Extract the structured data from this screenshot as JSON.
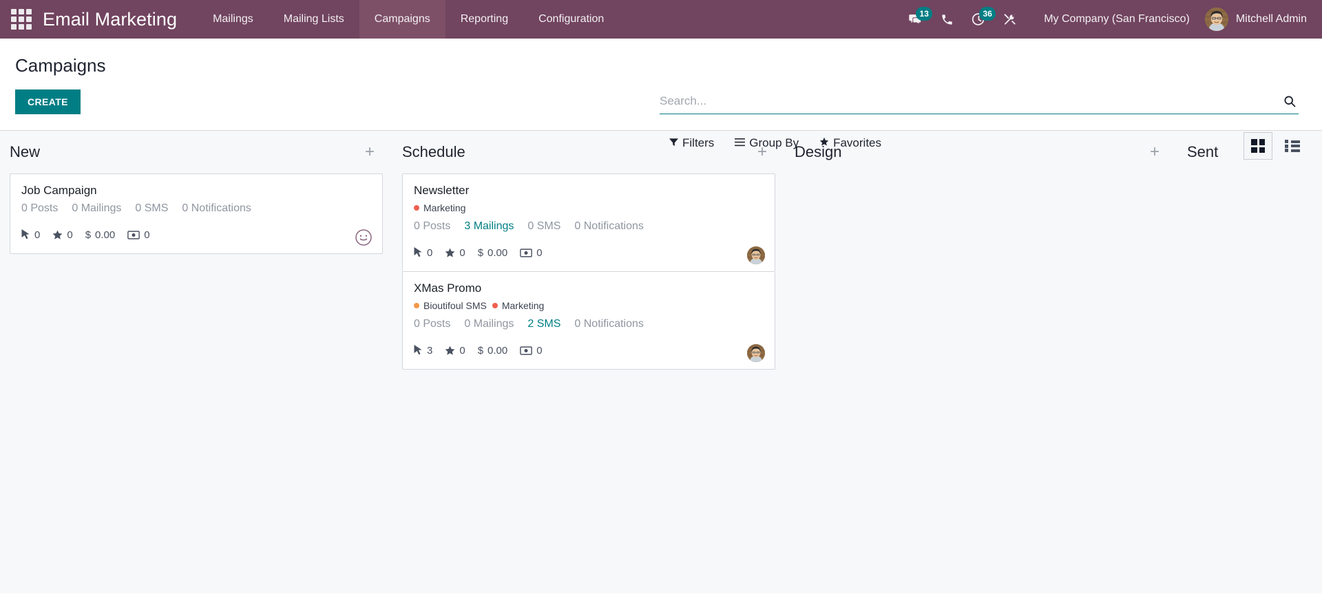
{
  "navbar": {
    "apps_icon": "apps-grid-icon",
    "brand": "Email Marketing",
    "menu": [
      {
        "label": "Mailings",
        "active": false
      },
      {
        "label": "Mailing Lists",
        "active": false
      },
      {
        "label": "Campaigns",
        "active": true
      },
      {
        "label": "Reporting",
        "active": false
      },
      {
        "label": "Configuration",
        "active": false
      }
    ],
    "icons": [
      {
        "name": "messages-icon",
        "badge": "13"
      },
      {
        "name": "phone-icon",
        "badge": ""
      },
      {
        "name": "activities-clock-icon",
        "badge": "36"
      },
      {
        "name": "developer-tools-icon",
        "badge": ""
      }
    ],
    "company": "My Company (San Francisco)",
    "user": "Mitchell Admin",
    "bg_color": "#71445F",
    "active_tab_color": "#7E5068",
    "badge_color": "#017E84"
  },
  "control_panel": {
    "title": "Campaigns",
    "create_label": "CREATE",
    "create_color": "#017E84",
    "search": {
      "placeholder": "Search...",
      "value": "",
      "icon": "search-icon"
    },
    "filters": [
      {
        "label": "Filters",
        "icon": "filter-funnel-icon"
      },
      {
        "label": "Group By",
        "icon": "bars-icon"
      },
      {
        "label": "Favorites",
        "icon": "star-icon"
      }
    ],
    "views": [
      {
        "name": "kanban-view-button",
        "icon": "kanban-icon",
        "active": true
      },
      {
        "name": "list-view-button",
        "icon": "list-icon",
        "active": false
      }
    ]
  },
  "kanban": {
    "add_symbol": "+",
    "columns": [
      {
        "title": "New",
        "cards": [
          {
            "title": "Job Campaign",
            "tags": [],
            "stats": [
              {
                "label": "0 Posts",
                "link": false
              },
              {
                "label": "0 Mailings",
                "link": false
              },
              {
                "label": "0 SMS",
                "link": false
              },
              {
                "label": "0 Notifications",
                "link": false
              }
            ],
            "metrics": [
              {
                "icon": "cursor-clicks-icon",
                "value": "0"
              },
              {
                "icon": "star-leads-icon",
                "value": "0"
              },
              {
                "icon": "dollar-icon",
                "value": "0.00"
              },
              {
                "icon": "banknote-revenue-icon",
                "value": "0"
              }
            ],
            "avatar": "smiley-placeholder"
          }
        ]
      },
      {
        "title": "Schedule",
        "cards": [
          {
            "title": "Newsletter",
            "tags": [
              {
                "label": "Marketing",
                "color": "#F06050"
              }
            ],
            "stats": [
              {
                "label": "0 Posts",
                "link": false
              },
              {
                "label": "3 Mailings",
                "link": true
              },
              {
                "label": "0 SMS",
                "link": false
              },
              {
                "label": "0 Notifications",
                "link": false
              }
            ],
            "metrics": [
              {
                "icon": "cursor-clicks-icon",
                "value": "0"
              },
              {
                "icon": "star-leads-icon",
                "value": "0"
              },
              {
                "icon": "dollar-icon",
                "value": "0.00"
              },
              {
                "icon": "banknote-revenue-icon",
                "value": "0"
              }
            ],
            "avatar": "user-photo"
          },
          {
            "title": "XMas Promo",
            "tags": [
              {
                "label": "Bioutifoul SMS",
                "color": "#F2994A"
              },
              {
                "label": "Marketing",
                "color": "#F06050"
              }
            ],
            "stats": [
              {
                "label": "0 Posts",
                "link": false
              },
              {
                "label": "0 Mailings",
                "link": false
              },
              {
                "label": "2 SMS",
                "link": true
              },
              {
                "label": "0 Notifications",
                "link": false
              }
            ],
            "metrics": [
              {
                "icon": "cursor-clicks-icon",
                "value": "3"
              },
              {
                "icon": "star-leads-icon",
                "value": "0"
              },
              {
                "icon": "dollar-icon",
                "value": "0.00"
              },
              {
                "icon": "banknote-revenue-icon",
                "value": "0"
              }
            ],
            "avatar": "user-photo"
          }
        ]
      },
      {
        "title": "Design",
        "cards": []
      },
      {
        "title": "Sent",
        "cards": []
      }
    ]
  }
}
